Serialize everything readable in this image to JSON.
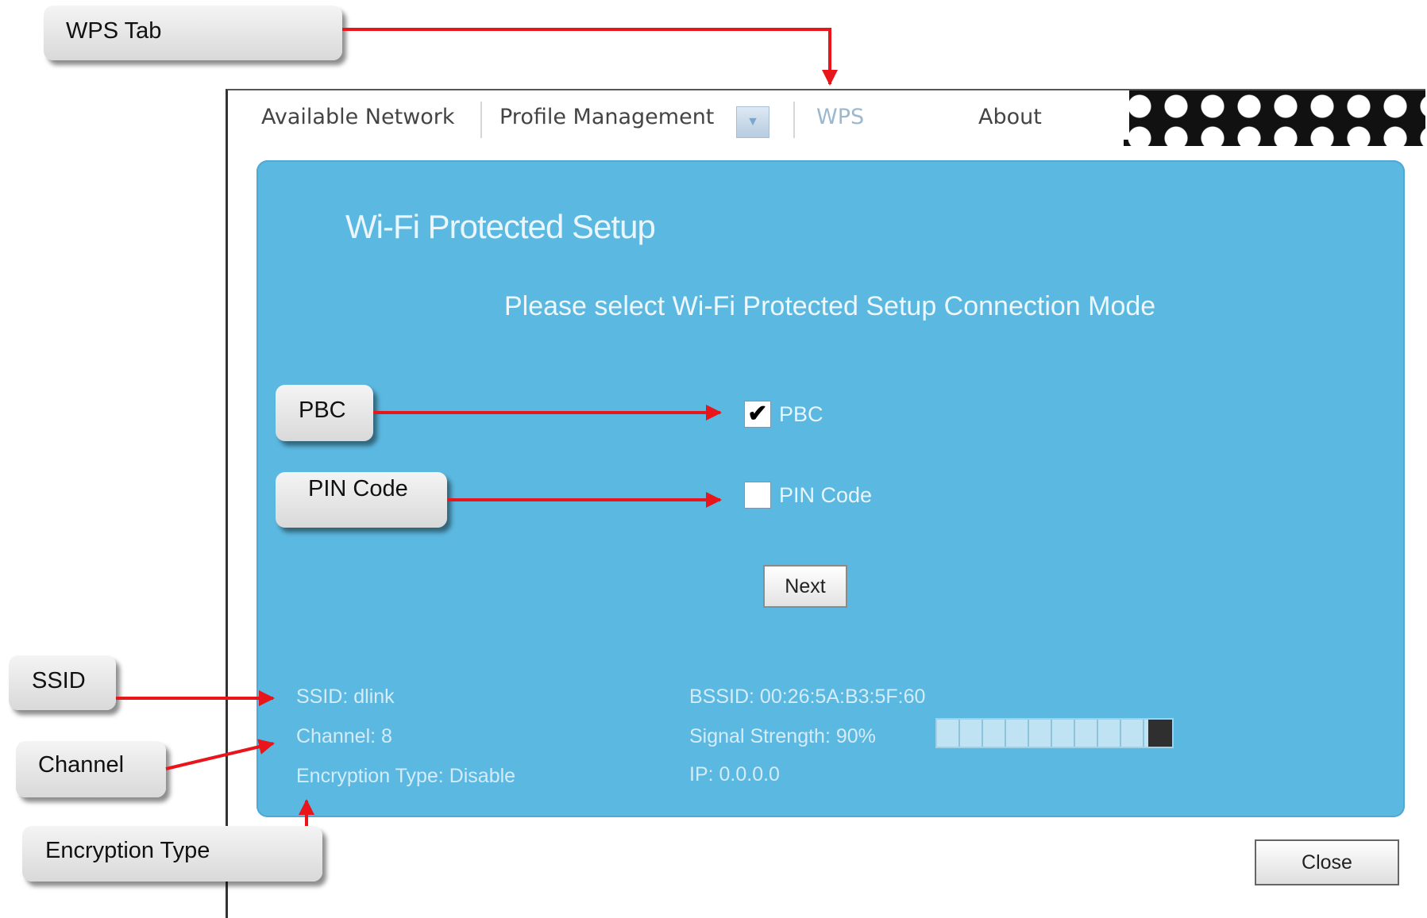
{
  "callouts": {
    "wps_tab": "WPS Tab",
    "pbc": "PBC",
    "pin_code": "PIN Code",
    "ssid": "SSID",
    "channel": "Channel",
    "encryption_type": "Encryption Type"
  },
  "tabs": [
    {
      "label": "Available Network"
    },
    {
      "label": "Profile Management"
    },
    {
      "label": "WPS"
    },
    {
      "label": "About"
    }
  ],
  "active_tab": "WPS",
  "panel": {
    "title": "Wi-Fi Protected Setup",
    "subtitle": "Please select Wi-Fi Protected Setup Connection Mode",
    "options": {
      "pbc": {
        "label": "PBC",
        "checked": true
      },
      "pin": {
        "label": "PIN Code",
        "checked": false
      }
    },
    "next_label": "Next"
  },
  "status": {
    "ssid": "SSID: dlink",
    "channel": "Channel: 8",
    "encryption": "Encryption Type: Disable",
    "bssid": "BSSID: 00:26:5A:B3:5F:60",
    "signal_strength": "Signal Strength: 90%",
    "signal_value": 90,
    "ip": "IP: 0.0.0.0"
  },
  "close_label": "Close",
  "colors": {
    "panel_background": "#5bb8e0",
    "arrow": "#e8151b",
    "active_tab_text": "#9ab8cf"
  }
}
